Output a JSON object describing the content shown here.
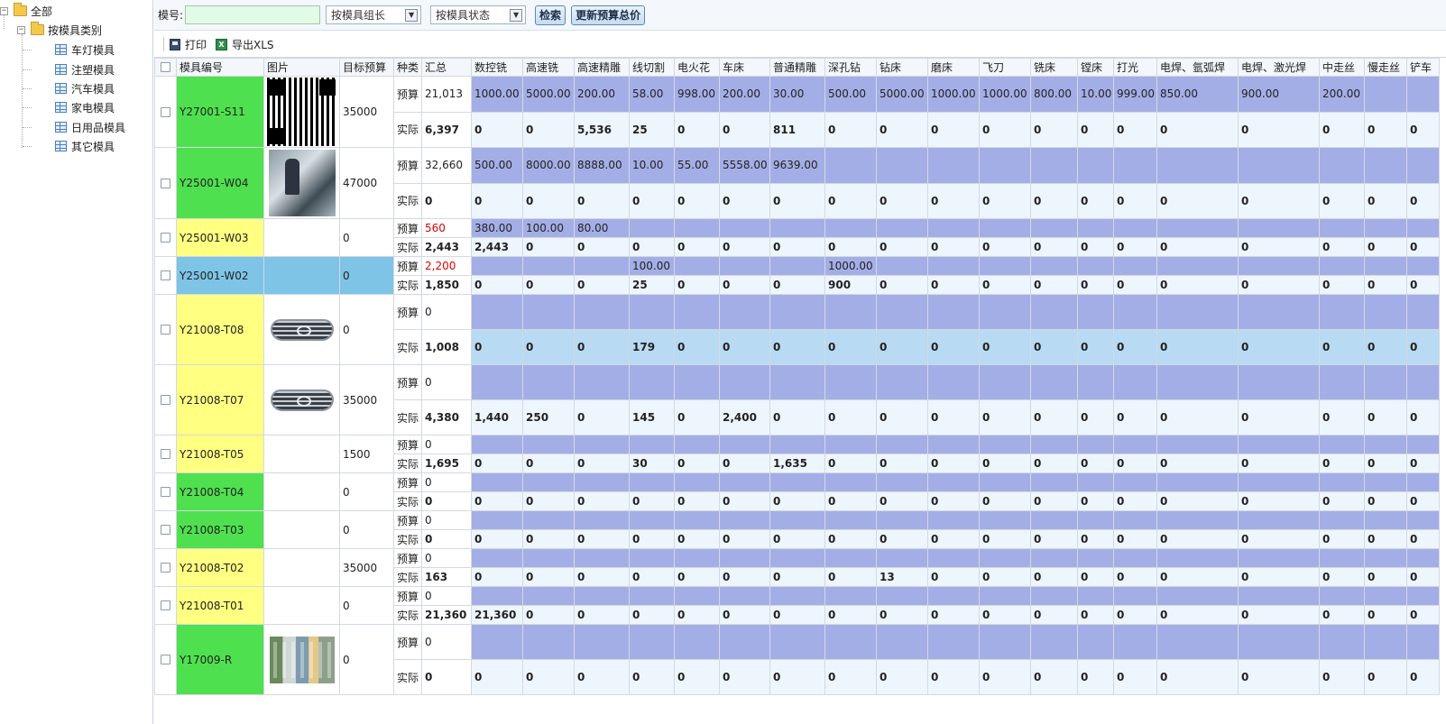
{
  "tree": {
    "root": "全部",
    "category": "按模具类别",
    "items": [
      "车灯模具",
      "注塑模具",
      "汽车模具",
      "家电模具",
      "日用品模具",
      "其它模具"
    ]
  },
  "toolbar": {
    "mold_label": "模号:",
    "mold_value": "",
    "group_select": "按模具组长",
    "status_select": "按模具状态",
    "search_button": "检索",
    "update_button": "更新预算总价",
    "print_label": "打印",
    "export_label": "导出XLS"
  },
  "table": {
    "headers": [
      "模具编号",
      "图片",
      "目标预算",
      "种类",
      "汇总",
      "数控铣",
      "高速铣",
      "高速精雕",
      "线切割",
      "电火花",
      "车床",
      "普通精雕",
      "深孔钻",
      "钻床",
      "磨床",
      "飞刀",
      "铣床",
      "镗床",
      "打光",
      "电焊、氩弧焊",
      "电焊、激光焊",
      "中走丝",
      "慢走丝",
      "铲车"
    ],
    "budget_label": "预算",
    "actual_label": "实际",
    "molds": [
      {
        "id": "Y27001-S11",
        "color": "green",
        "image": "qr",
        "target": "35000",
        "tall": true,
        "budget_total": "21,013",
        "budget_total_red": false,
        "budget_bg": true,
        "budget": [
          "1000.00",
          "5000.00",
          "200.00",
          "58.00",
          "998.00",
          "200.00",
          "30.00",
          "500.00",
          "5000.00",
          "1000.00",
          "1000.00",
          "800.00",
          "10.00",
          "999.00",
          "850.00",
          "900.00",
          "200.00",
          "",
          ""
        ],
        "actual_total": "6,397",
        "actual": [
          "0",
          "0",
          "5,536",
          "25",
          "0",
          "0",
          "811",
          "0",
          "0",
          "0",
          "0",
          "0",
          "0",
          "0",
          "0",
          "0",
          "0",
          "0",
          "0"
        ],
        "actual_lb": false
      },
      {
        "id": "Y25001-W04",
        "color": "green",
        "image": "photo",
        "target": "47000",
        "tall": true,
        "budget_total": "32,660",
        "budget_total_red": false,
        "budget_bg": true,
        "budget": [
          "500.00",
          "8000.00",
          "8888.00",
          "10.00",
          "55.00",
          "5558.00",
          "9639.00",
          "",
          "",
          "",
          "",
          "",
          "",
          "",
          "",
          "",
          "",
          "",
          ""
        ],
        "actual_total": "0",
        "actual": [
          "0",
          "0",
          "0",
          "0",
          "0",
          "0",
          "0",
          "0",
          "0",
          "0",
          "0",
          "0",
          "0",
          "0",
          "0",
          "0",
          "0",
          "0",
          "0"
        ],
        "actual_lb": false
      },
      {
        "id": "Y25001-W03",
        "color": "yellow",
        "image": "",
        "target": "0",
        "tall": false,
        "budget_total": "560",
        "budget_total_red": true,
        "budget_bg": true,
        "budget": [
          "380.00",
          "100.00",
          "80.00",
          "",
          "",
          "",
          "",
          "",
          "",
          "",
          "",
          "",
          "",
          "",
          "",
          "",
          "",
          "",
          ""
        ],
        "actual_total": "2,443",
        "actual": [
          "2,443",
          "0",
          "0",
          "0",
          "0",
          "0",
          "0",
          "0",
          "0",
          "0",
          "0",
          "0",
          "0",
          "0",
          "0",
          "0",
          "0",
          "0",
          "0"
        ],
        "actual_lb": false
      },
      {
        "id": "Y25001-W02",
        "color": "sel",
        "image": "",
        "target": "0",
        "tall": false,
        "budget_total": "2,200",
        "budget_total_red": true,
        "budget_bg": true,
        "budget": [
          "",
          "",
          "",
          "100.00",
          "",
          "",
          "",
          "1000.00",
          "",
          "",
          "",
          "",
          "",
          "",
          "",
          "",
          "",
          "",
          ""
        ],
        "actual_total": "1,850",
        "actual": [
          "0",
          "0",
          "0",
          "25",
          "0",
          "0",
          "0",
          "900",
          "0",
          "0",
          "0",
          "0",
          "0",
          "0",
          "0",
          "0",
          "0",
          "0",
          "0"
        ],
        "actual_lb": false
      },
      {
        "id": "Y21008-T08",
        "color": "yellow",
        "image": "grille",
        "target": "0",
        "tall": true,
        "budget_total": "0",
        "budget_total_red": false,
        "budget_bg": true,
        "budget": [
          "",
          "",
          "",
          "",
          "",
          "",
          "",
          "",
          "",
          "",
          "",
          "",
          "",
          "",
          "",
          "",
          "",
          "",
          ""
        ],
        "actual_total": "1,008",
        "actual": [
          "0",
          "0",
          "0",
          "179",
          "0",
          "0",
          "0",
          "0",
          "0",
          "0",
          "0",
          "0",
          "0",
          "0",
          "0",
          "0",
          "0",
          "0",
          "0"
        ],
        "actual_lb": true
      },
      {
        "id": "Y21008-T07",
        "color": "yellow",
        "image": "grille",
        "target": "35000",
        "tall": true,
        "budget_total": "0",
        "budget_total_red": false,
        "budget_bg": true,
        "budget": [
          "",
          "",
          "",
          "",
          "",
          "",
          "",
          "",
          "",
          "",
          "",
          "",
          "",
          "",
          "",
          "",
          "",
          "",
          ""
        ],
        "actual_total": "4,380",
        "actual": [
          "1,440",
          "250",
          "0",
          "145",
          "0",
          "2,400",
          "0",
          "0",
          "0",
          "0",
          "0",
          "0",
          "0",
          "0",
          "0",
          "0",
          "0",
          "0",
          "0"
        ],
        "actual_lb": false
      },
      {
        "id": "Y21008-T05",
        "color": "yellow",
        "image": "",
        "target": "1500",
        "tall": false,
        "budget_total": "0",
        "budget_total_red": false,
        "budget_bg": true,
        "budget": [
          "",
          "",
          "",
          "",
          "",
          "",
          "",
          "",
          "",
          "",
          "",
          "",
          "",
          "",
          "",
          "",
          "",
          "",
          ""
        ],
        "actual_total": "1,695",
        "actual": [
          "0",
          "0",
          "0",
          "30",
          "0",
          "0",
          "1,635",
          "0",
          "0",
          "0",
          "0",
          "0",
          "0",
          "0",
          "0",
          "0",
          "0",
          "0",
          "0"
        ],
        "actual_lb": false
      },
      {
        "id": "Y21008-T04",
        "color": "green",
        "image": "",
        "target": "0",
        "tall": false,
        "budget_total": "0",
        "budget_total_red": false,
        "budget_bg": true,
        "budget": [
          "",
          "",
          "",
          "",
          "",
          "",
          "",
          "",
          "",
          "",
          "",
          "",
          "",
          "",
          "",
          "",
          "",
          "",
          ""
        ],
        "actual_total": "0",
        "actual": [
          "0",
          "0",
          "0",
          "0",
          "0",
          "0",
          "0",
          "0",
          "0",
          "0",
          "0",
          "0",
          "0",
          "0",
          "0",
          "0",
          "0",
          "0",
          "0"
        ],
        "actual_lb": false
      },
      {
        "id": "Y21008-T03",
        "color": "green",
        "image": "",
        "target": "0",
        "tall": false,
        "budget_total": "0",
        "budget_total_red": false,
        "budget_bg": true,
        "budget": [
          "",
          "",
          "",
          "",
          "",
          "",
          "",
          "",
          "",
          "",
          "",
          "",
          "",
          "",
          "",
          "",
          "",
          "",
          ""
        ],
        "actual_total": "0",
        "actual": [
          "0",
          "0",
          "0",
          "0",
          "0",
          "0",
          "0",
          "0",
          "0",
          "0",
          "0",
          "0",
          "0",
          "0",
          "0",
          "0",
          "0",
          "0",
          "0"
        ],
        "actual_lb": false
      },
      {
        "id": "Y21008-T02",
        "color": "yellow",
        "image": "",
        "target": "35000",
        "tall": false,
        "budget_total": "0",
        "budget_total_red": false,
        "budget_bg": true,
        "budget": [
          "",
          "",
          "",
          "",
          "",
          "",
          "",
          "",
          "",
          "",
          "",
          "",
          "",
          "",
          "",
          "",
          "",
          "",
          ""
        ],
        "actual_total": "163",
        "actual": [
          "0",
          "0",
          "0",
          "0",
          "0",
          "0",
          "0",
          "0",
          "13",
          "0",
          "0",
          "0",
          "0",
          "0",
          "0",
          "0",
          "0",
          "0",
          "0"
        ],
        "actual_lb": false
      },
      {
        "id": "Y21008-T01",
        "color": "yellow",
        "image": "",
        "target": "0",
        "tall": false,
        "budget_total": "0",
        "budget_total_red": false,
        "budget_bg": true,
        "budget": [
          "",
          "",
          "",
          "",
          "",
          "",
          "",
          "",
          "",
          "",
          "",
          "",
          "",
          "",
          "",
          "",
          "",
          "",
          ""
        ],
        "actual_total": "21,360",
        "actual": [
          "21,360",
          "0",
          "0",
          "0",
          "0",
          "0",
          "0",
          "0",
          "0",
          "0",
          "0",
          "0",
          "0",
          "0",
          "0",
          "0",
          "0",
          "0",
          "0"
        ],
        "actual_lb": false
      },
      {
        "id": "Y17009-R",
        "color": "green",
        "image": "building",
        "target": "0",
        "tall": true,
        "budget_total": "0",
        "budget_total_red": false,
        "budget_bg": true,
        "budget": [
          "",
          "",
          "",
          "",
          "",
          "",
          "",
          "",
          "",
          "",
          "",
          "",
          "",
          "",
          "",
          "",
          "",
          "",
          ""
        ],
        "actual_total": "0",
        "actual": [
          "0",
          "0",
          "0",
          "0",
          "0",
          "0",
          "0",
          "0",
          "0",
          "0",
          "0",
          "0",
          "0",
          "0",
          "0",
          "0",
          "0",
          "0",
          "0"
        ],
        "actual_lb": false
      }
    ]
  },
  "colors": {
    "id_green": "#4fe04f",
    "id_yellow": "#ffff82",
    "selected": "#7ec4e6",
    "budget_row": "#a4aee6",
    "actual_row": "#eef6fd",
    "red_total": "#e00000"
  }
}
